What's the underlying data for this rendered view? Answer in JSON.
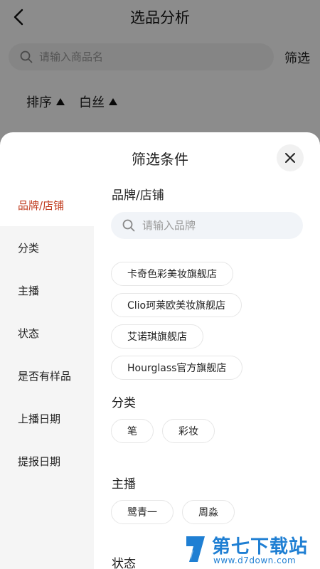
{
  "header": {
    "title": "选品分析"
  },
  "search": {
    "placeholder": "请输入商品名",
    "filter_label": "筛选"
  },
  "sort": {
    "items": [
      {
        "label": "排序"
      },
      {
        "label": "白丝"
      }
    ]
  },
  "sheet": {
    "title": "筛选条件",
    "sidebar": [
      {
        "label": "品牌/店铺",
        "active": true
      },
      {
        "label": "分类"
      },
      {
        "label": "主播"
      },
      {
        "label": "状态"
      },
      {
        "label": "是否有样品"
      },
      {
        "label": "上播日期"
      },
      {
        "label": "提报日期"
      }
    ],
    "brand": {
      "title": "品牌/店铺",
      "search_placeholder": "请输入品牌",
      "options": [
        "卡奇色彩美妆旗舰店",
        "Clio珂莱欧美妆旗舰店",
        "艾诺琪旗舰店",
        "Hourglass官方旗舰店"
      ]
    },
    "category": {
      "title": "分类",
      "options": [
        "笔",
        "彩妆"
      ]
    },
    "anchor": {
      "title": "主播",
      "options": [
        "鹭青一",
        "周淼"
      ]
    },
    "status": {
      "title": "状态"
    }
  },
  "colors": {
    "accent": "#c0391b",
    "watermark": "#1f7fd3"
  },
  "watermark": {
    "name": "第七下载站",
    "url": "www.d7down.com"
  }
}
